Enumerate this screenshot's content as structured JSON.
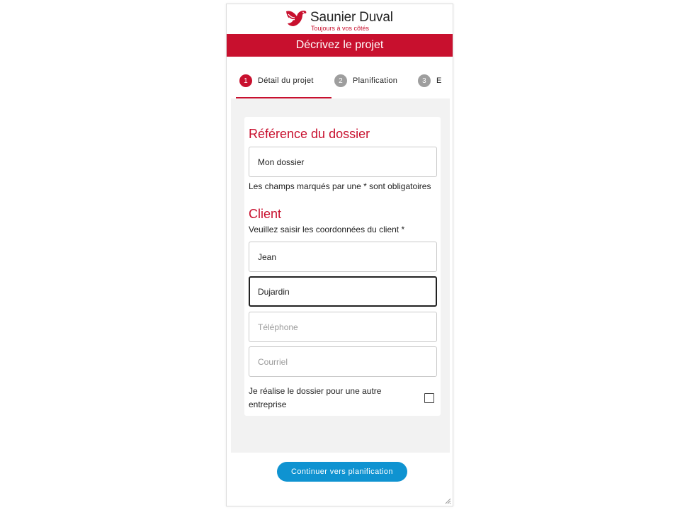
{
  "brand": {
    "name": "Saunier Duval",
    "tagline": "Toujours à vos côtés",
    "logo_icon": "bird-icon",
    "accent_color": "#c8102e"
  },
  "header": {
    "title": "Décrivez le projet"
  },
  "stepper": {
    "steps": [
      {
        "number": "1",
        "label": "Détail du projet",
        "active": true
      },
      {
        "number": "2",
        "label": "Planification",
        "active": false
      },
      {
        "number": "3",
        "label": "E",
        "active": false
      }
    ]
  },
  "reference": {
    "title": "Référence du dossier",
    "value": "Mon dossier",
    "required_note": "Les champs marqués par une * sont obligatoires"
  },
  "client": {
    "title": "Client",
    "instructions": "Veuillez saisir les coordonnées du client *",
    "first_name": "Jean",
    "last_name": "Dujardin",
    "phone_placeholder": "Téléphone",
    "email_placeholder": "Courriel"
  },
  "other_company": {
    "label": "Je réalise le dossier pour une autre entreprise",
    "checked": false
  },
  "footer": {
    "continue_label": "Continuer vers planification",
    "button_color": "#0f93d1"
  }
}
